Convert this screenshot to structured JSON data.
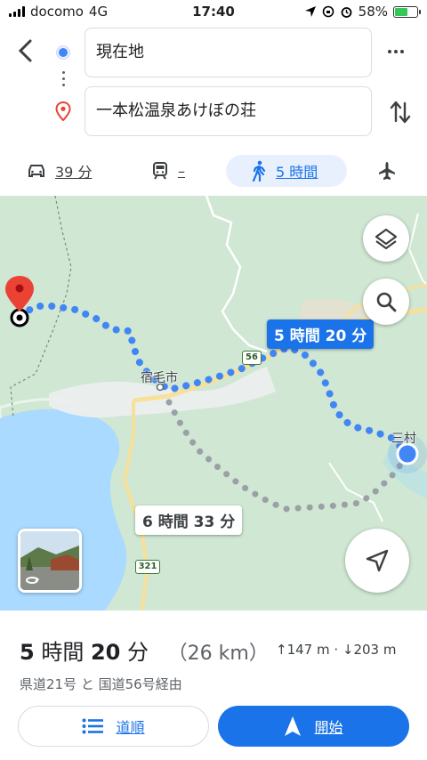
{
  "status_bar": {
    "carrier": "docomo",
    "network": "4G",
    "time": "17:40",
    "battery": "58%",
    "battery_level": 0.58
  },
  "search": {
    "origin": "現在地",
    "destination": "一本松温泉あけぼの荘"
  },
  "modes": {
    "car": "39 分",
    "transit": "–",
    "walk": "5 時間",
    "active": "walk"
  },
  "map": {
    "primary_route_duration": "5 時間 20 分",
    "alt_route_duration": "6 時間 33 分",
    "town_label": "宿毛市",
    "edge_label": "三村",
    "route_shields": [
      "56",
      "321"
    ],
    "colors": {
      "route": "#4285f4",
      "alt_route": "#9aa0a6",
      "water": "#aadaff",
      "land": "#cfe7d3",
      "pin": "#ea4335"
    }
  },
  "summary": {
    "hours": "5",
    "hours_unit": "時間",
    "minutes": "20",
    "minutes_unit": "分",
    "distance": "（26 km）",
    "elevation": "↑147 m · ↓203 m",
    "via": "県道21号 と 国道56号経由"
  },
  "actions": {
    "steps": "道順",
    "start": "開始"
  }
}
